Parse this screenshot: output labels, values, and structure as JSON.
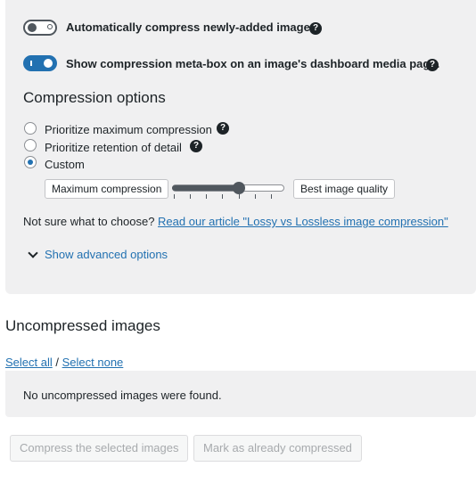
{
  "settings": {
    "auto_compress_label": "Automatically compress newly-added images",
    "auto_compress_enabled": false,
    "meta_box_label": "Show compression meta-box on an image's dashboard media page.",
    "meta_box_enabled": true,
    "help_glyph": "?"
  },
  "compression": {
    "heading": "Compression options",
    "options": [
      {
        "label": "Prioritize maximum compression",
        "checked": false,
        "has_help": true
      },
      {
        "label": "Prioritize retention of detail",
        "checked": false,
        "has_help": true
      },
      {
        "label": "Custom",
        "checked": true,
        "has_help": false
      }
    ],
    "slider": {
      "min_label": "Maximum compression",
      "max_label": "Best image quality",
      "value_fraction": 0.6,
      "ticks": 7
    },
    "help_text": "Not sure what to choose?",
    "article_link": "Read our article \"Lossy vs Lossless image compression\"",
    "advanced_toggle": "Show advanced options",
    "advanced_icon": "chevron-down-icon"
  },
  "uncompressed": {
    "heading": "Uncompressed images",
    "select_all": "Select all",
    "separator": "/",
    "select_none": "Select none",
    "empty_message": "No uncompressed images were found.",
    "compress_button": "Compress the selected images",
    "mark_button": "Mark as already compressed"
  },
  "colors": {
    "accent": "#2271b1",
    "panel_bg": "#f0f0f1",
    "text": "#1d2327",
    "disabled_text": "#a7aaad"
  }
}
